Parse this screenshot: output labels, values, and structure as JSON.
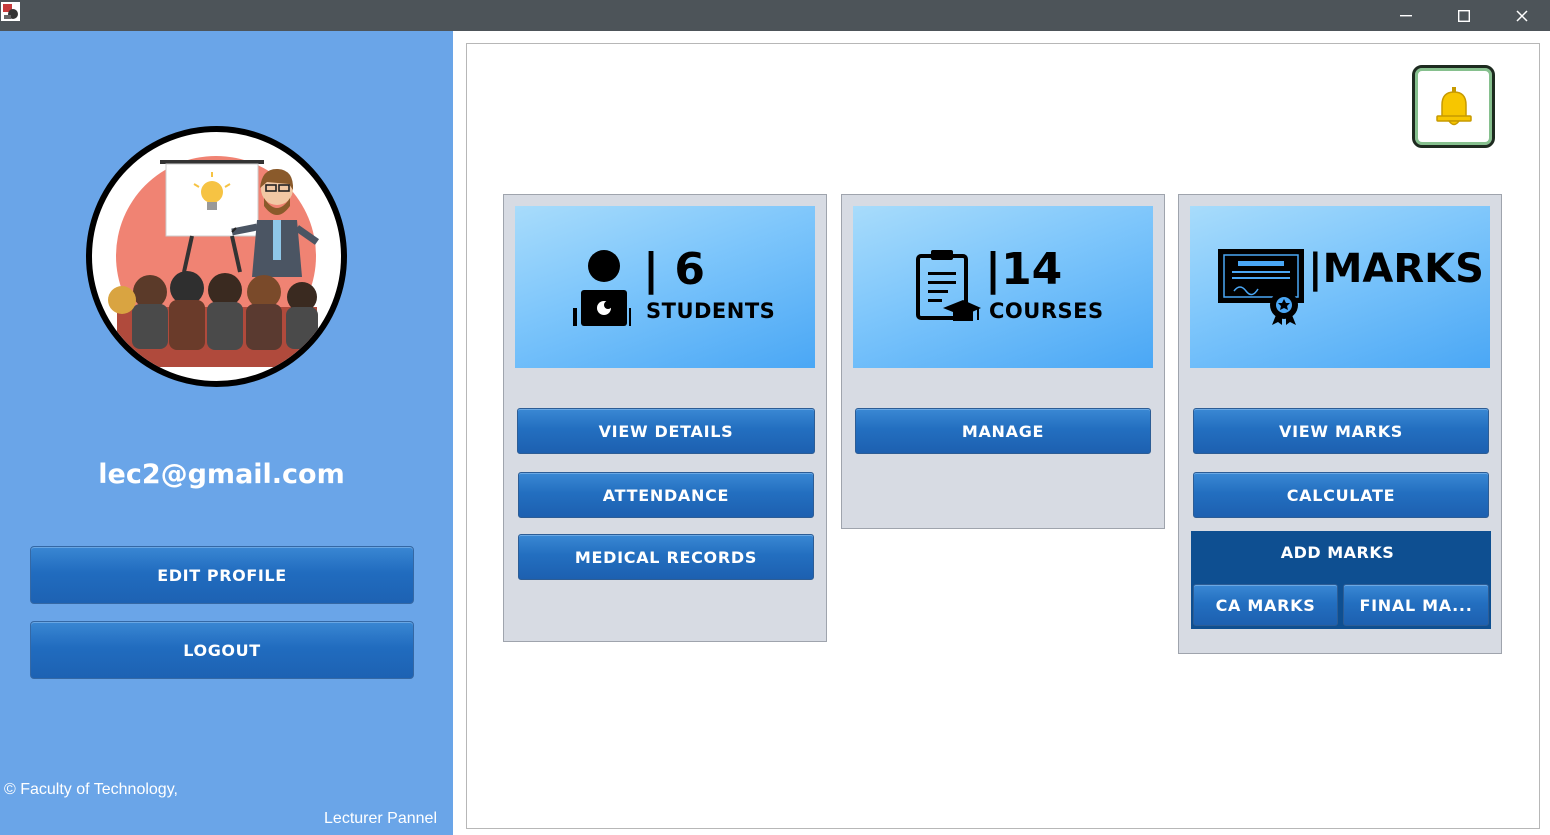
{
  "titlebar": {
    "icons": {
      "app": "app-icon",
      "minimize": "minimize-icon",
      "maximize": "maximize-icon",
      "close": "close-icon"
    }
  },
  "sidebar": {
    "avatar_icon": "lecturer-presentation-icon",
    "email": "lec2@gmail.com",
    "edit_profile": "EDIT PROFILE",
    "logout": "LOGOUT",
    "footer_line1": "© Faculty of Technology,",
    "footer_line2": "Lecturer Pannel"
  },
  "main": {
    "bell_icon": "bell-icon",
    "students": {
      "count": "| 6",
      "label": "STUDENTS",
      "icon": "student-laptop-icon",
      "buttons": [
        "VIEW DETAILS",
        "ATTENDANCE",
        "MEDICAL RECORDS"
      ]
    },
    "courses": {
      "count": "|14",
      "label": "COURSES",
      "icon": "clipboard-graduation-icon",
      "buttons": [
        "MANAGE"
      ]
    },
    "marks": {
      "label": "|MARKS",
      "icon": "certificate-icon",
      "buttons": [
        "VIEW MARKS",
        "CALCULATE"
      ],
      "add_marks": {
        "title": "ADD MARKS",
        "buttons": [
          "CA MARKS",
          "FINAL MA..."
        ]
      }
    }
  },
  "colors": {
    "sidebar": "#6aa5e8",
    "button_blue": "#216cbf",
    "titlebar": "#4d5459",
    "card_bg": "#d7dbe3",
    "add_marks_bg": "#0e4f91"
  }
}
